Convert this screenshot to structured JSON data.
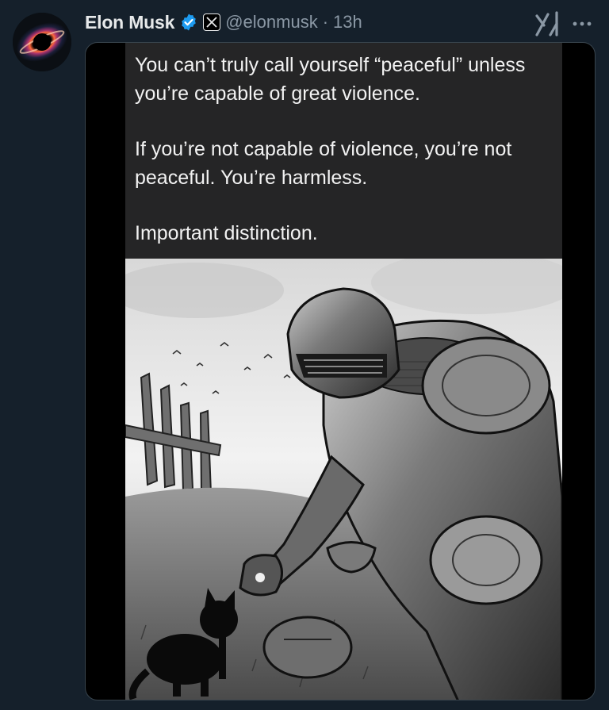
{
  "post": {
    "author_name": "Elon Musk",
    "handle": "@elonmusk",
    "separator": "·",
    "time": "13h",
    "avatar_icon": "black-hole-avatar",
    "verified_icon": "verified-badge-icon",
    "affiliation_icon": "x-logo-icon",
    "grok_icon": "grok-icon",
    "more_icon": "more-options-icon"
  },
  "meme": {
    "line1": "You can’t truly call yourself “peaceful” unless you’re capable of great violence.",
    "line2": "If you’re not capable of violence, you’re not peaceful. You’re harmless.",
    "line3": "Important distinction."
  },
  "colors": {
    "background": "#15202b",
    "name_text": "#e7e9ea",
    "secondary_text": "#8b98a5",
    "verified_blue": "#1d9bf0",
    "meme_background": "#252526"
  }
}
